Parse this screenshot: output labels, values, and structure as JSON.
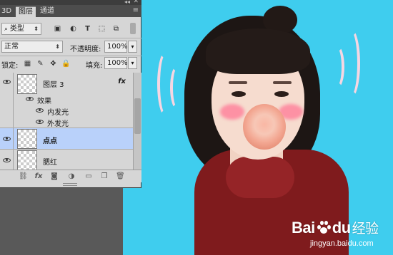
{
  "panel": {
    "tabs": [
      "3D",
      "图层",
      "通道"
    ],
    "active_tab": 1,
    "filter_label": "类型",
    "blend_mode": "正常",
    "opacity_label": "不透明度:",
    "opacity_value": "100%",
    "lock_label": "锁定:",
    "fill_label": "填充:",
    "fill_value": "100%"
  },
  "layers": [
    {
      "name": "图层 3",
      "fx": "fx",
      "effects_label": "效果",
      "effects": [
        "内发光",
        "外发光"
      ]
    },
    {
      "name": "点点",
      "selected": true
    },
    {
      "name": "腮红"
    }
  ],
  "watermark": {
    "logo_prefix": "Bai",
    "logo_middle": "du",
    "logo_suffix": "经验",
    "url": "jingyan.baidu.com"
  },
  "colors": {
    "canvas_bg": "#3fcdee",
    "panel_bg": "#d6d6d6",
    "selection": "#b9d1fa"
  }
}
